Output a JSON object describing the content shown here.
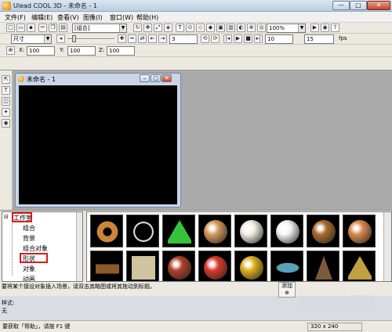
{
  "titlebar": {
    "title": "Ulead COOL 3D - 未命名 - 1",
    "min": "—",
    "max": "□",
    "close": "✕"
  },
  "menu": [
    "文件(F)",
    "编辑(E)",
    "查看(V)",
    "图像(I)",
    "窗口(W)",
    "帮助(H)"
  ],
  "toolbar1": {
    "object_combo": "[组合]",
    "zoom_combo": "100%"
  },
  "toolbar2": {
    "size_combo": "尺寸",
    "frame_value": "3",
    "frame_total": "10",
    "fps_value": "15",
    "fps_label": "fps"
  },
  "toolbar3": {
    "x_label": "X:",
    "x_value": "100",
    "y_label": "Y:",
    "y_value": "100",
    "z_label": "Z:",
    "z_value": "100"
  },
  "child_window": {
    "title": "未命名 - 1"
  },
  "tree": {
    "root": "工作室",
    "items": [
      "组合",
      "背景",
      "组合对象",
      "形状",
      "对象",
      "动画"
    ]
  },
  "gallery": {
    "items": [
      {
        "name": "donut-thumb",
        "color": "#c9853a"
      },
      {
        "name": "ring-thumb",
        "color": "#d8d8d8"
      },
      {
        "name": "cone-thumb",
        "color": "#36c23a"
      },
      {
        "name": "disc-thumb",
        "color": "#d49a5a"
      },
      {
        "name": "pearls-thumb",
        "color": "#f0eee0"
      },
      {
        "name": "snowman-thumb",
        "color": "#f4f4f4"
      },
      {
        "name": "bear-thumb",
        "color": "#a96a2c"
      },
      {
        "name": "gingerbread-thumb",
        "color": "#d98a4a"
      },
      {
        "name": "brick-thumb",
        "color": "#8a5a2a"
      },
      {
        "name": "box-thumb",
        "color": "#cfc3a0"
      },
      {
        "name": "football-thumb",
        "color": "#b0402a"
      },
      {
        "name": "ball-red-thumb",
        "color": "#d83a2a"
      },
      {
        "name": "ball-gold-thumb",
        "color": "#e0b020"
      },
      {
        "name": "ufo-thumb",
        "color": "#5aa0b8"
      },
      {
        "name": "cone-brown-thumb",
        "color": "#7a5a3a"
      },
      {
        "name": "pyramid-thumb",
        "color": "#c0a040"
      }
    ]
  },
  "hint": "要将某个接设对象插入场景，请双击其略图或将其拖动到标题。",
  "add_button": "添加",
  "style": {
    "label": "样式:",
    "value": "无"
  },
  "status": {
    "text": "要获取「帮助」，请按 F1 键",
    "size": "320 x 240"
  },
  "watermark": "Baidu 经验"
}
